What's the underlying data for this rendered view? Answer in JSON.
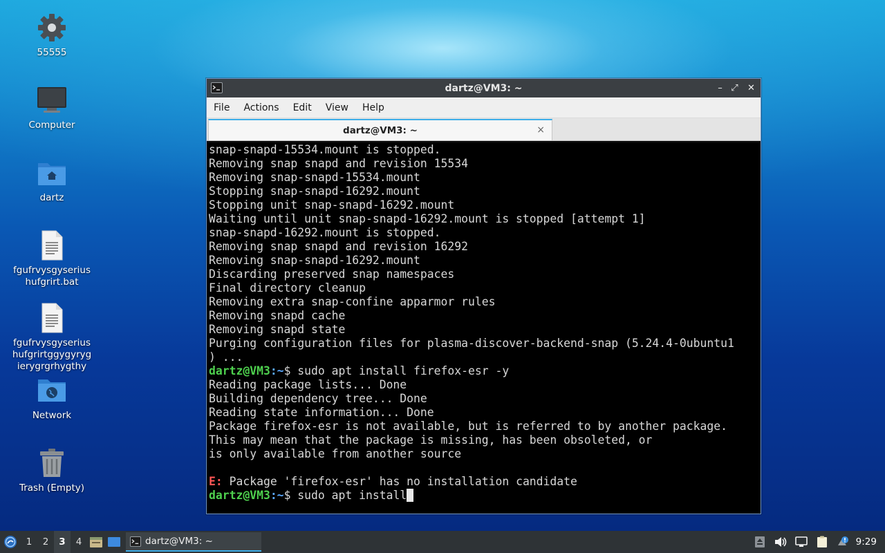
{
  "desktop": {
    "icons": [
      {
        "label": "55555",
        "icon": "gear-icon"
      },
      {
        "label": "Computer",
        "icon": "monitor-icon"
      },
      {
        "label": "dartz",
        "icon": "home-folder-icon"
      },
      {
        "label": "fgufrvysgyserius hufgrirt.bat",
        "icon": "text-file-icon"
      },
      {
        "label": "fgufrvysgyserius hufgrirtggygyryg ierygrgrhygthy",
        "icon": "text-file-icon"
      },
      {
        "label": "Network",
        "icon": "network-folder-icon"
      },
      {
        "label": "Trash (Empty)",
        "icon": "trash-icon"
      }
    ]
  },
  "window": {
    "title": "dartz@VM3: ~",
    "menu": [
      "File",
      "Actions",
      "Edit",
      "View",
      "Help"
    ],
    "tab_label": "dartz@VM3: ~",
    "tab_close": "×",
    "controls": {
      "minimize": "–",
      "maximize": "⤢",
      "close": "✕"
    }
  },
  "terminal": {
    "prompt_user": "dartz@VM3",
    "prompt_path": ":~",
    "prompt_symbol": "$",
    "lines": [
      "snap-snapd-15534.mount is stopped.",
      "Removing snap snapd and revision 15534",
      "Removing snap-snapd-15534.mount",
      "Stopping snap-snapd-16292.mount",
      "Stopping unit snap-snapd-16292.mount",
      "Waiting until unit snap-snapd-16292.mount is stopped [attempt 1]",
      "snap-snapd-16292.mount is stopped.",
      "Removing snap snapd and revision 16292",
      "Removing snap-snapd-16292.mount",
      "Discarding preserved snap namespaces",
      "Final directory cleanup",
      "Removing extra snap-confine apparmor rules",
      "Removing snapd cache",
      "Removing snapd state",
      "Purging configuration files for plasma-discover-backend-snap (5.24.4-0ubuntu1",
      ") ..."
    ],
    "command_1": " sudo apt install firefox-esr -y",
    "output_after": [
      "Reading package lists... Done",
      "Building dependency tree... Done",
      "Reading state information... Done",
      "Package firefox-esr is not available, but is referred to by another package.",
      "This may mean that the package is missing, has been obsoleted, or",
      "is only available from another source",
      ""
    ],
    "error_prefix": "E:",
    "error_text": " Package 'firefox-esr' has no installation candidate",
    "current_input": " sudo apt install"
  },
  "taskbar": {
    "workspaces": [
      "1",
      "2",
      "3",
      "4"
    ],
    "active_workspace": "3",
    "task_label": "dartz@VM3: ~",
    "clock": "9:29"
  }
}
